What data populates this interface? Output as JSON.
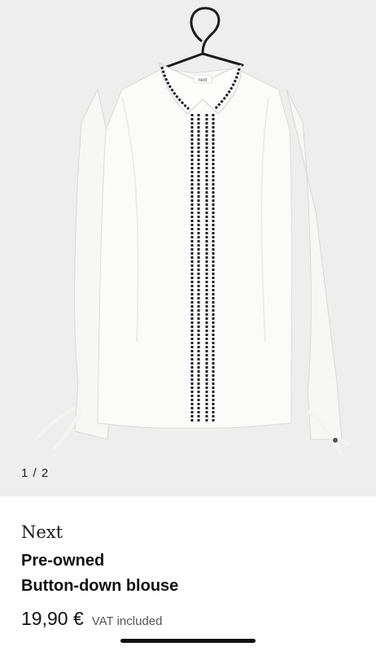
{
  "gallery": {
    "counter": "1 / 2",
    "label_text": "next"
  },
  "product": {
    "brand": "Next",
    "condition": "Pre-owned",
    "title": "Button-down blouse",
    "price": "19,90 €",
    "vat_note": "VAT included"
  },
  "colors": {
    "background": "#eeeeee",
    "shirt": "#fbfbfa",
    "trim": "#1c1c2a",
    "text": "#111111"
  }
}
